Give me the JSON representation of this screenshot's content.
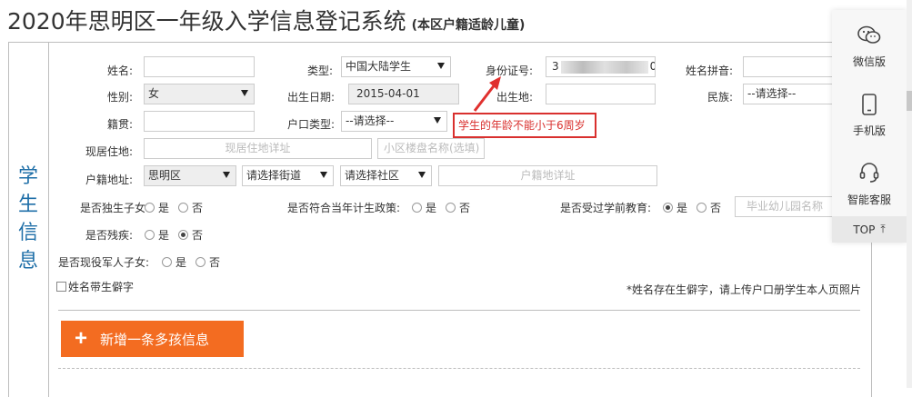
{
  "title": "2020年思明区一年级入学信息登记系统",
  "subtitle": "(本区户籍适龄儿童)",
  "section_label": "学生信息",
  "fields": {
    "name_label": "姓名:",
    "type_label": "类型:",
    "type_value": "中国大陆学生",
    "id_label": "身份证号:",
    "id_prefix": "3",
    "id_suffix": "0",
    "pinyin_label": "姓名拼音:",
    "gender_label": "性别:",
    "gender_value": "女",
    "birthdate_label": "出生日期:",
    "birthdate_value": "2015-04-01",
    "birthplace_label": "出生地:",
    "ethnicity_label": "民族:",
    "ethnicity_value": "--请选择--",
    "native_label": "籍贯:",
    "hukou_type_label": "户口类型:",
    "hukou_type_value": "--请选择--",
    "address_label": "现居住地:",
    "address_placeholder": "现居住地详址",
    "community_placeholder": "小区楼盘名称(选填)",
    "hukou_addr_label": "户籍地址:",
    "district_value": "思明区",
    "street_value": "请选择街道",
    "neighborhood_value": "请选择社区",
    "hukou_detail_placeholder": "户籍地详址"
  },
  "error_message": "学生的年龄不能小于6周岁",
  "questions": {
    "only_child": "是否独生子女:",
    "family_policy": "是否符合当年计生政策:",
    "preschool": "是否受过学前教育:",
    "disabled": "是否残疾:",
    "military": "是否现役军人子女:",
    "yes": "是",
    "no": "否",
    "kindergarten_placeholder": "毕业幼儿园名称"
  },
  "rare_char_label": "姓名带生僻字",
  "rare_char_note": "*姓名存在生僻字，请上传户口册学生本人页照片",
  "add_button_label": "新增一条多孩信息",
  "float": {
    "wechat": "微信版",
    "mobile": "手机版",
    "service": "智能客服",
    "top": "TOP"
  },
  "colors": {
    "accent_orange": "#f36c21",
    "error_red": "#d9302e",
    "section_blue": "#1f6fa8"
  }
}
